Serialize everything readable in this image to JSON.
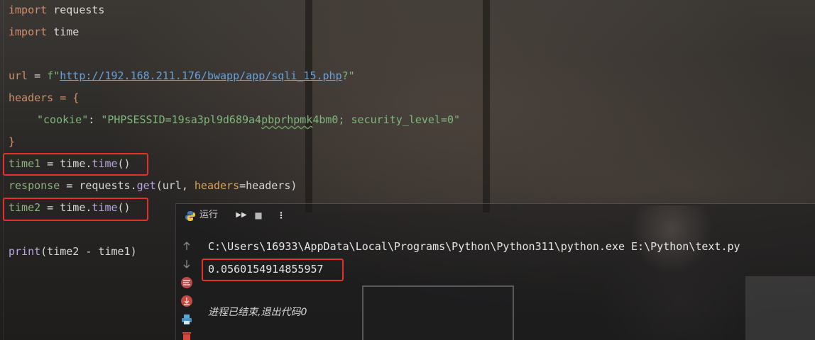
{
  "code": {
    "l1_kw": "import",
    "l1_rest": " requests",
    "l2_kw": "import",
    "l2_rest": " time",
    "l4_var": "url",
    "l4_eq": " = ",
    "l4_prefix": "f\"",
    "l4_url": "http://192.168.211.176/bwapp/app/sqli_15.php",
    "l4_suffix": "?\"",
    "l5_var": "headers",
    "l5_rest": " = {",
    "l6_key": "\"cookie\"",
    "l6_colon": ": ",
    "l6_val_a": "\"PHPSESSID=19sa3pl9d689a4",
    "l6_val_sq": "pbprhpmk",
    "l6_val_b": "4bm0; security_level=0\"",
    "l7": "}",
    "l8_var": "time1",
    "l8_eq": " = time.",
    "l8_fn": "time",
    "l8_paren": "()",
    "l9_var": "response",
    "l9_a": " = requests.",
    "l9_fn": "get",
    "l9_b": "(url, ",
    "l9_param": "headers",
    "l9_c": "=headers)",
    "l10_var": "time2",
    "l10_eq": " = time.",
    "l10_fn": "time",
    "l10_paren": "()",
    "l12_fn": "print",
    "l12_a": "(time2 ",
    "l12_b": "- time1)"
  },
  "run_panel": {
    "tab_label": "运行",
    "rerun_label": "▶▶",
    "stop_label": "■",
    "more_label": "⋮",
    "command": "C:\\Users\\16933\\AppData\\Local\\Programs\\Python\\Python311\\python.exe E:\\Python\\text.py",
    "output": "0.0560154914855957",
    "exit_message": "进程已结束,退出代码0"
  },
  "colors": {
    "highlight": "#e2322a",
    "keyword": "#cf8e6d",
    "string": "#7fb67c",
    "url": "#6aa0d8"
  },
  "icons": [
    "python-icon",
    "rerun-icon",
    "stop-icon",
    "more-icon",
    "scroll-up-icon",
    "scroll-down-icon",
    "soft-wrap-icon",
    "scroll-to-end-icon",
    "print-icon",
    "delete-icon"
  ]
}
